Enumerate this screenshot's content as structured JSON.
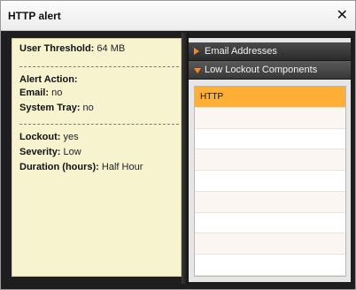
{
  "dialog": {
    "title": "HTTP alert",
    "close_glyph": "✕"
  },
  "summary": {
    "threshold_label": "User Threshold:",
    "threshold_value": "64 MB",
    "alert_action_label": "Alert Action:",
    "email_label": "Email:",
    "email_value": "no",
    "tray_label": "System Tray:",
    "tray_value": "no",
    "lockout_label": "Lockout:",
    "lockout_value": "yes",
    "severity_label": "Severity:",
    "severity_value": "Low",
    "duration_label": "Duration (hours):",
    "duration_value": "Half Hour"
  },
  "accordion": {
    "sections": [
      {
        "label": "Email Addresses",
        "expanded": false,
        "icon": "arrow-right-icon"
      },
      {
        "label": "Low Lockout Components",
        "expanded": true,
        "icon": "arrow-down-icon"
      }
    ],
    "list_items": [
      "HTTP",
      "",
      "",
      "",
      "",
      "",
      "",
      "",
      ""
    ],
    "selected_index": 0
  },
  "colors": {
    "panel_bg": "#f7f3cf",
    "selected_row": "#ffae36",
    "accent_arrow": "#ff8a1c"
  }
}
